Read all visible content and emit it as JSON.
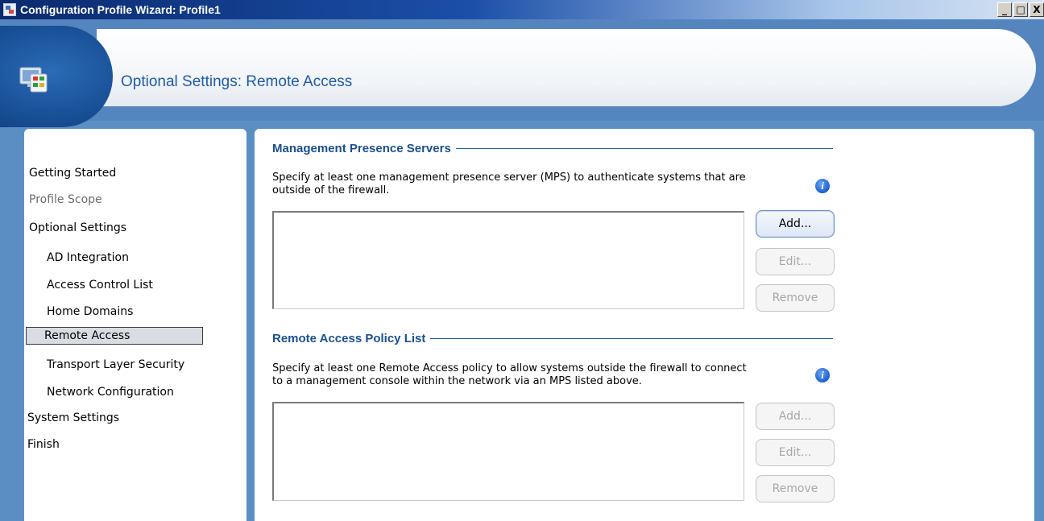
{
  "window": {
    "title": "Configuration Profile Wizard: Profile1",
    "controls": [
      "_",
      "□",
      "X"
    ]
  },
  "header": {
    "title": "Optional Settings: Remote Access"
  },
  "nav": {
    "items": [
      {
        "label": "Getting Started",
        "state": "normal",
        "indent": false
      },
      {
        "label": "Profile Scope",
        "state": "disabled",
        "indent": false
      },
      {
        "label": "Optional Settings",
        "state": "normal",
        "indent": false
      },
      {
        "label": "AD Integration",
        "state": "normal",
        "indent": true
      },
      {
        "label": "Access Control List",
        "state": "normal",
        "indent": true
      },
      {
        "label": "Home Domains",
        "state": "normal",
        "indent": true
      },
      {
        "label": "Remote Access",
        "state": "selected",
        "indent": true
      },
      {
        "label": "Transport Layer Security",
        "state": "normal",
        "indent": true
      },
      {
        "label": "Network Configuration",
        "state": "normal",
        "indent": true
      },
      {
        "label": "System Settings",
        "state": "normal",
        "indent": false
      },
      {
        "label": "Finish",
        "state": "normal",
        "indent": false
      }
    ]
  },
  "mps": {
    "heading": "Management Presence Servers",
    "description_line1": "Specify at least one management presence server (MPS) to authenticate systems that are",
    "description_line2": "outside of the firewall.",
    "add_label": "Add...",
    "edit_label": "Edit...",
    "remove_label": "Remove"
  },
  "policy": {
    "heading": "Remote Access Policy List",
    "description_line1": "Specify at least one Remote Access policy to allow systems outside the firewall to connect",
    "description_line2": "to a management console within the network via an MPS listed above.",
    "add_label": "Add...",
    "edit_label": "Edit...",
    "remove_label": "Remove"
  },
  "info_glyph": "i",
  "colors": {
    "accent": "#1f5ba6",
    "frame": "#5585bf"
  }
}
